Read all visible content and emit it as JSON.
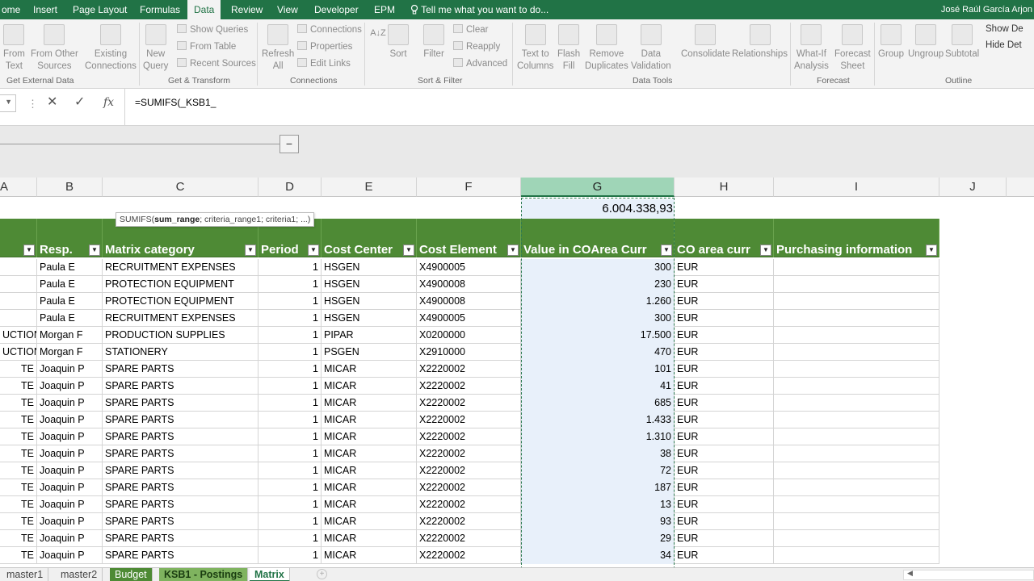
{
  "ribbon_tabs": [
    "ome",
    "Insert",
    "Page Layout",
    "Formulas",
    "Data",
    "Review",
    "View",
    "Developer",
    "EPM"
  ],
  "active_tab": "Data",
  "tell_me": "Tell me what you want to do...",
  "user_name": "José Raúl García Arjon",
  "ribbon": {
    "from_text": [
      "From",
      "Text"
    ],
    "from_other": [
      "From Other",
      "Sources"
    ],
    "existing": [
      "Existing",
      "Connections"
    ],
    "new_query": [
      "New",
      "Query"
    ],
    "show_queries": "Show Queries",
    "from_table": "From Table",
    "recent_sources": "Recent Sources",
    "refresh_all": [
      "Refresh",
      "All"
    ],
    "connections": "Connections",
    "properties": "Properties",
    "edit_links": "Edit Links",
    "sort": "Sort",
    "filter": "Filter",
    "clear": "Clear",
    "reapply": "Reapply",
    "advanced": "Advanced",
    "text_to_columns": [
      "Text to",
      "Columns"
    ],
    "flash_fill": [
      "Flash",
      "Fill"
    ],
    "remove_duplicates": [
      "Remove",
      "Duplicates"
    ],
    "data_validation": [
      "Data",
      "Validation"
    ],
    "consolidate": "Consolidate",
    "relationships": "Relationships",
    "what_if": [
      "What-If",
      "Analysis"
    ],
    "forecast_sheet": [
      "Forecast",
      "Sheet"
    ],
    "group": "Group",
    "ungroup": "Ungroup",
    "subtotal": "Subtotal",
    "show_detail": "Show De",
    "hide_detail": "Hide Det",
    "groups": [
      "Get External Data",
      "Get & Transform",
      "Connections",
      "Sort & Filter",
      "Data Tools",
      "Forecast",
      "Outline"
    ]
  },
  "formula": "=SUMIFS(_KSB1_",
  "outline_button": "−",
  "columns": [
    "A",
    "B",
    "C",
    "D",
    "E",
    "F",
    "G",
    "H",
    "I",
    "J"
  ],
  "total_value": "6.004.338,93",
  "tooltip": {
    "prefix": "SUMIFS(",
    "bold": "sum_range",
    "rest": "; criteria_range1; criteria1; ...)"
  },
  "headers": [
    "",
    "Resp.",
    "Matrix category",
    "Period",
    "Cost Center",
    "Cost Element",
    "Value in COArea Curr",
    "CO area curr",
    "Purchasing information"
  ],
  "rows": [
    [
      "",
      "Paula E",
      "RECRUITMENT EXPENSES",
      "1",
      "HSGEN",
      "X4900005",
      "300",
      "EUR",
      ""
    ],
    [
      "",
      "Paula E",
      "PROTECTION EQUIPMENT",
      "1",
      "HSGEN",
      "X4900008",
      "230",
      "EUR",
      ""
    ],
    [
      "",
      "Paula E",
      "PROTECTION EQUIPMENT",
      "1",
      "HSGEN",
      "X4900008",
      "1.260",
      "EUR",
      ""
    ],
    [
      "",
      "Paula E",
      "RECRUITMENT EXPENSES",
      "1",
      "HSGEN",
      "X4900005",
      "300",
      "EUR",
      ""
    ],
    [
      "UCTION",
      "Morgan F",
      "PRODUCTION SUPPLIES",
      "1",
      "PIPAR",
      "X0200000",
      "17.500",
      "EUR",
      ""
    ],
    [
      "UCTION",
      "Morgan F",
      "STATIONERY",
      "1",
      "PSGEN",
      "X2910000",
      "470",
      "EUR",
      ""
    ],
    [
      "TE",
      "Joaquin P",
      "SPARE PARTS",
      "1",
      "MICAR",
      "X2220002",
      "101",
      "EUR",
      ""
    ],
    [
      "TE",
      "Joaquin P",
      "SPARE PARTS",
      "1",
      "MICAR",
      "X2220002",
      "41",
      "EUR",
      ""
    ],
    [
      "TE",
      "Joaquin P",
      "SPARE PARTS",
      "1",
      "MICAR",
      "X2220002",
      "685",
      "EUR",
      ""
    ],
    [
      "TE",
      "Joaquin P",
      "SPARE PARTS",
      "1",
      "MICAR",
      "X2220002",
      "1.433",
      "EUR",
      ""
    ],
    [
      "TE",
      "Joaquin P",
      "SPARE PARTS",
      "1",
      "MICAR",
      "X2220002",
      "1.310",
      "EUR",
      ""
    ],
    [
      "TE",
      "Joaquin P",
      "SPARE PARTS",
      "1",
      "MICAR",
      "X2220002",
      "38",
      "EUR",
      ""
    ],
    [
      "TE",
      "Joaquin P",
      "SPARE PARTS",
      "1",
      "MICAR",
      "X2220002",
      "72",
      "EUR",
      ""
    ],
    [
      "TE",
      "Joaquin P",
      "SPARE PARTS",
      "1",
      "MICAR",
      "X2220002",
      "187",
      "EUR",
      ""
    ],
    [
      "TE",
      "Joaquin P",
      "SPARE PARTS",
      "1",
      "MICAR",
      "X2220002",
      "13",
      "EUR",
      ""
    ],
    [
      "TE",
      "Joaquin P",
      "SPARE PARTS",
      "1",
      "MICAR",
      "X2220002",
      "93",
      "EUR",
      ""
    ],
    [
      "TE",
      "Joaquin P",
      "SPARE PARTS",
      "1",
      "MICAR",
      "X2220002",
      "29",
      "EUR",
      ""
    ],
    [
      "TE",
      "Joaquin P",
      "SPARE PARTS",
      "1",
      "MICAR",
      "X2220002",
      "34",
      "EUR",
      ""
    ]
  ],
  "sheet_tabs": [
    "master1",
    "master2",
    "Budget",
    "KSB1 - Postings",
    "Matrix"
  ],
  "active_sheet": "Matrix",
  "colors": {
    "excel_green": "#217346",
    "header_green": "#4e8a35",
    "selection": "#e8f0fa"
  }
}
